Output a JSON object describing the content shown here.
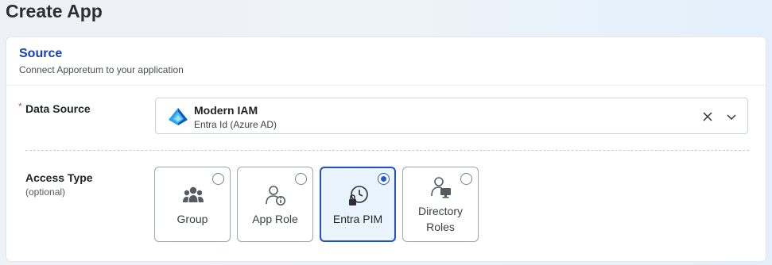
{
  "page": {
    "title": "Create App"
  },
  "source": {
    "title": "Source",
    "subtitle": "Connect Apporetum to your application",
    "data_source": {
      "label": "Data Source",
      "required_marker": "*",
      "selected_title": "Modern IAM",
      "selected_subtitle": "Entra Id (Azure AD)",
      "logo_icon": "azure-entra-logo",
      "clear_icon": "close-icon",
      "expand_icon": "chevron-down-icon"
    },
    "access_type": {
      "label": "Access Type",
      "hint": "(optional)",
      "options": [
        {
          "label": "Group",
          "icon": "users-group-icon",
          "selected": false
        },
        {
          "label": "App Role",
          "icon": "user-info-icon",
          "selected": false
        },
        {
          "label": "Entra PIM",
          "icon": "lock-clock-icon",
          "selected": true
        },
        {
          "label_line1": "Directory",
          "label_line2": "Roles",
          "icon": "user-monitor-icon",
          "selected": false
        }
      ]
    }
  },
  "colors": {
    "accent": "#1f4fc9",
    "section_title": "#1840b8",
    "required": "#d63a3a",
    "selected_tile_bg": "#eaf4fd"
  }
}
